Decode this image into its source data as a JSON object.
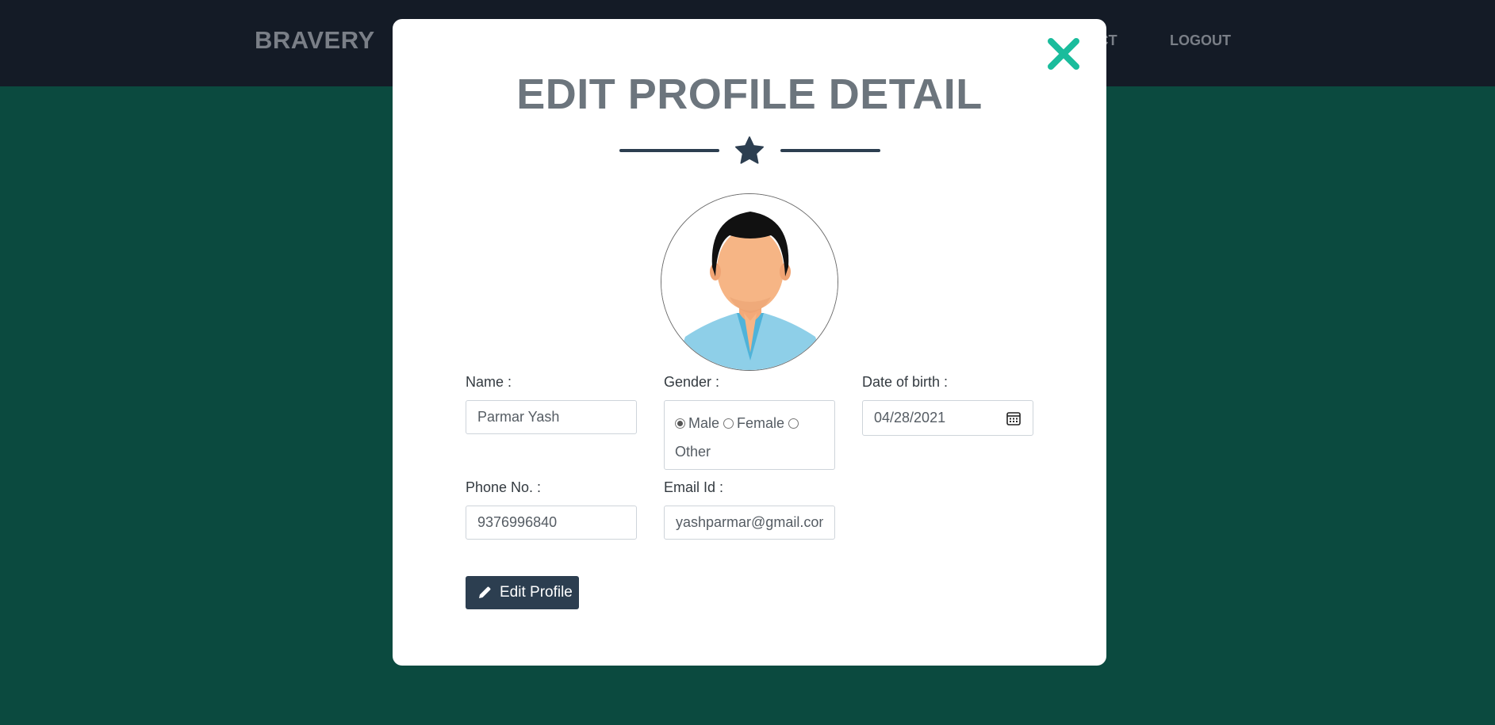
{
  "navbar": {
    "brand": "BRAVERY",
    "links": [
      "TACT",
      "LOGOUT"
    ]
  },
  "modal": {
    "title": "EDIT PROFILE DETAIL",
    "icons": {
      "close": "close-icon",
      "divider": "star-icon",
      "avatar": "user-avatar",
      "date": "calendar-icon",
      "edit": "pencil-icon"
    },
    "fields": {
      "name": {
        "label": "Name :",
        "value": "Parmar Yash"
      },
      "gender": {
        "label": "Gender :",
        "options": [
          "Male",
          "Female",
          "Other"
        ],
        "selected": "Male"
      },
      "dob": {
        "label": "Date of birth :",
        "value": "04/28/2021"
      },
      "phone": {
        "label": "Phone No. :",
        "value": "9376996840"
      },
      "email": {
        "label": "Email Id :",
        "value": "yashparmar@gmail.com"
      }
    },
    "edit_button": "Edit Profile"
  },
  "colors": {
    "background": "#0b4a3f",
    "navbar": "#141b26",
    "accent": "#1abc9c",
    "primary": "#2c3e50"
  }
}
